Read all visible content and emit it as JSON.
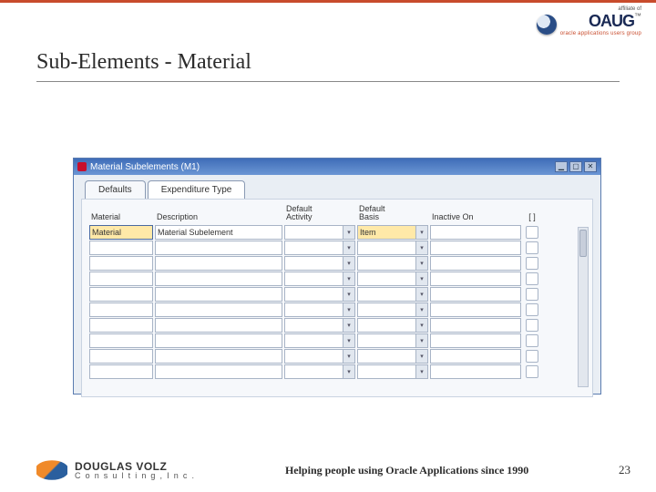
{
  "header": {
    "affiliate_of": "affiliate of",
    "oaug": "OAUG",
    "oaug_sub": "oracle applications users group",
    "tm": "™"
  },
  "slide_title": "Sub-Elements - Material",
  "window": {
    "title": "Material Subelements (M1)",
    "btn_min": "▁",
    "btn_max": "▢",
    "btn_close": "✕",
    "tabs": {
      "defaults": "Defaults",
      "expenditure": "Expenditure Type"
    },
    "columns": {
      "material": "Material",
      "description": "Description",
      "default_activity": "Default\nActivity",
      "default_basis": "Default\nBasis",
      "inactive_on": "Inactive On",
      "bracket": "[ ]"
    },
    "first_row": {
      "material": "Material",
      "description": "Material Subelement",
      "basis": "Item"
    },
    "combo_glyph": "▾"
  },
  "footer": {
    "dv_line1": "DOUGLAS VOLZ",
    "dv_line2": "C o n s u l t i n g ,   I n c .",
    "tagline": "Helping people using Oracle Applications since 1990",
    "page": "23"
  }
}
